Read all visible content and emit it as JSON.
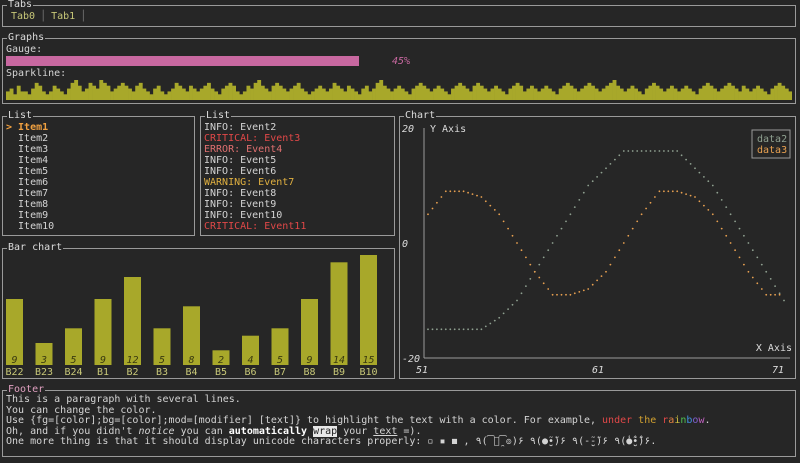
{
  "tabs_panel": {
    "title": "Tabs",
    "tabs": [
      {
        "label": "Tab0"
      },
      {
        "label": "Tab1"
      }
    ]
  },
  "graphs_panel": {
    "title": "Graphs",
    "gauge_label": "Gauge:",
    "gauge_percent_text": "45%",
    "gauge_value": 0.45,
    "sparkline_label": "Sparkline:",
    "sparkline_values": [
      3,
      4,
      2,
      5,
      3,
      3,
      2,
      4,
      6,
      5,
      3,
      2,
      3,
      5,
      4,
      3,
      2,
      4,
      6,
      7,
      5,
      3,
      4,
      6,
      5,
      4,
      7,
      6,
      5,
      3,
      4,
      5,
      6,
      5,
      4,
      3,
      5,
      6,
      4,
      3,
      2,
      4,
      5,
      3,
      2,
      3,
      4,
      6,
      5,
      4,
      3,
      5,
      4,
      3,
      4,
      5,
      6,
      4,
      3,
      2,
      4,
      5,
      6,
      5,
      3,
      2,
      3,
      5,
      4,
      6,
      7,
      5,
      4,
      3,
      5,
      6,
      5,
      4,
      3,
      4,
      5,
      6,
      4,
      3,
      2,
      3,
      4,
      5,
      4,
      3,
      4,
      6,
      5,
      4,
      3,
      5,
      4,
      3,
      2,
      4,
      5,
      3,
      4,
      6,
      7,
      5,
      4,
      3,
      4,
      5,
      4,
      3,
      2,
      4,
      5,
      6,
      5,
      4,
      3,
      4,
      5,
      4,
      3,
      2,
      4,
      5,
      6,
      5,
      4,
      3,
      5,
      6,
      5,
      4,
      3,
      4,
      5,
      4,
      3,
      2,
      4,
      5,
      6,
      5,
      3,
      4,
      5,
      4,
      3,
      4,
      5,
      4,
      3,
      2,
      4,
      5,
      6,
      5,
      4,
      3,
      4,
      5,
      6,
      5,
      4,
      3,
      4,
      5,
      6,
      7,
      5,
      4,
      3,
      4,
      5,
      4,
      3,
      2,
      4,
      5,
      6,
      5,
      4,
      3,
      4,
      5,
      4,
      3,
      4,
      5,
      4,
      3,
      2,
      4,
      5,
      6,
      5,
      4,
      3,
      4,
      5,
      6,
      5,
      4,
      3,
      5,
      4,
      3,
      4,
      5,
      4,
      3,
      2,
      4,
      5,
      6,
      5,
      4,
      3
    ]
  },
  "list1": {
    "title": "List",
    "selected_prefix": ">",
    "items": [
      "Item1",
      "Item2",
      "Item3",
      "Item4",
      "Item5",
      "Item6",
      "Item7",
      "Item8",
      "Item9",
      "Item10"
    ]
  },
  "list2": {
    "title": "List",
    "items": [
      {
        "text": "INFO: Event2",
        "color": "#d4d4d4"
      },
      {
        "text": "CRITICAL: Event3",
        "color": "#e04848"
      },
      {
        "text": "ERROR: Event4",
        "color": "#e07070"
      },
      {
        "text": "INFO: Event5",
        "color": "#d4d4d4"
      },
      {
        "text": "INFO: Event6",
        "color": "#d4d4d4"
      },
      {
        "text": "WARNING: Event7",
        "color": "#e0b040"
      },
      {
        "text": "INFO: Event8",
        "color": "#d4d4d4"
      },
      {
        "text": "INFO: Event9",
        "color": "#d4d4d4"
      },
      {
        "text": "INFO: Event10",
        "color": "#d4d4d4"
      },
      {
        "text": "CRITICAL: Event11",
        "color": "#e04848"
      }
    ]
  },
  "chart_data": [
    {
      "type": "line",
      "title": "Chart",
      "ylabel": "Y Axis",
      "xlabel": "X Axis",
      "xlim": [
        51,
        71
      ],
      "ylim": [
        -20,
        20
      ],
      "x_ticks": [
        "51",
        "61",
        "71"
      ],
      "y_ticks": [
        "20",
        "0",
        "-20"
      ],
      "legend_position": "top-right",
      "series": [
        {
          "name": "data2",
          "color": "#8fa090",
          "points": [
            [
              51,
              -15
            ],
            [
              52,
              -15
            ],
            [
              53,
              -15
            ],
            [
              54,
              -15
            ],
            [
              55,
              -13
            ],
            [
              56,
              -10
            ],
            [
              57,
              -5
            ],
            [
              58,
              0
            ],
            [
              59,
              5
            ],
            [
              60,
              10
            ],
            [
              61,
              13
            ],
            [
              62,
              16
            ],
            [
              63,
              16
            ],
            [
              64,
              16
            ],
            [
              65,
              16
            ],
            [
              66,
              13
            ],
            [
              67,
              10
            ],
            [
              68,
              5
            ],
            [
              69,
              0
            ],
            [
              70,
              -5
            ],
            [
              71,
              -10
            ],
            [
              72,
              -13
            ],
            [
              73,
              -15
            ],
            [
              74,
              -15
            ],
            [
              75,
              -15
            ]
          ]
        },
        {
          "name": "data3",
          "color": "#e8a050",
          "points": [
            [
              51,
              5
            ],
            [
              52,
              9
            ],
            [
              53,
              9
            ],
            [
              54,
              8
            ],
            [
              55,
              5
            ],
            [
              56,
              0
            ],
            [
              57,
              -5
            ],
            [
              58,
              -9
            ],
            [
              59,
              -9
            ],
            [
              60,
              -8
            ],
            [
              61,
              -5
            ],
            [
              62,
              0
            ],
            [
              63,
              5
            ],
            [
              64,
              9
            ],
            [
              65,
              9
            ],
            [
              66,
              8
            ],
            [
              67,
              5
            ],
            [
              68,
              0
            ],
            [
              69,
              -5
            ],
            [
              70,
              -9
            ],
            [
              71,
              -9
            ]
          ]
        }
      ]
    },
    {
      "type": "bar",
      "title": "Bar chart",
      "categories": [
        "B22",
        "B23",
        "B24",
        "B1",
        "B2",
        "B3",
        "B4",
        "B5",
        "B6",
        "B7",
        "B8",
        "B9",
        "B10"
      ],
      "values": [
        9,
        3,
        5,
        9,
        12,
        5,
        8,
        2,
        4,
        5,
        9,
        14,
        15
      ],
      "ylim": [
        0,
        15
      ],
      "bar_color": "#a8a82a",
      "value_label_color": "#3a3a10",
      "category_label_color": "#c8c878"
    }
  ],
  "footer": {
    "title": "Footer",
    "line1": "This is a paragraph with several lines.",
    "line2": "You can change the color.",
    "line3_a": "Use {fg=[color];bg=[color];mod=[modifier] [text]} to highlight the text with a color. For example, ",
    "line3_under": "under",
    "line3_sp1": " ",
    "line3_the": "the",
    "line3_sp2": " ",
    "line3_rainbow": "rainbow",
    "line3_end": ".",
    "line4_a": "Oh, and if you didn't ",
    "line4_notice": "notice",
    "line4_b": " you can ",
    "line4_auto": "automatically",
    "line4_sp": " ",
    "line4_wrap": "wrap",
    "line4_c": " your ",
    "line4_text": "text",
    "line4_end": " =).",
    "line5": "One more thing is that it should display unicode characters properly: ▫ ▪ ◼ , ٩(͡๏̯͡๏)۶ ٩(●̮̮̃•̃)۶ ٩(-̮̮̃-̃)۶ ٩(̾●̮̮̃̾•̃̾)۶."
  }
}
